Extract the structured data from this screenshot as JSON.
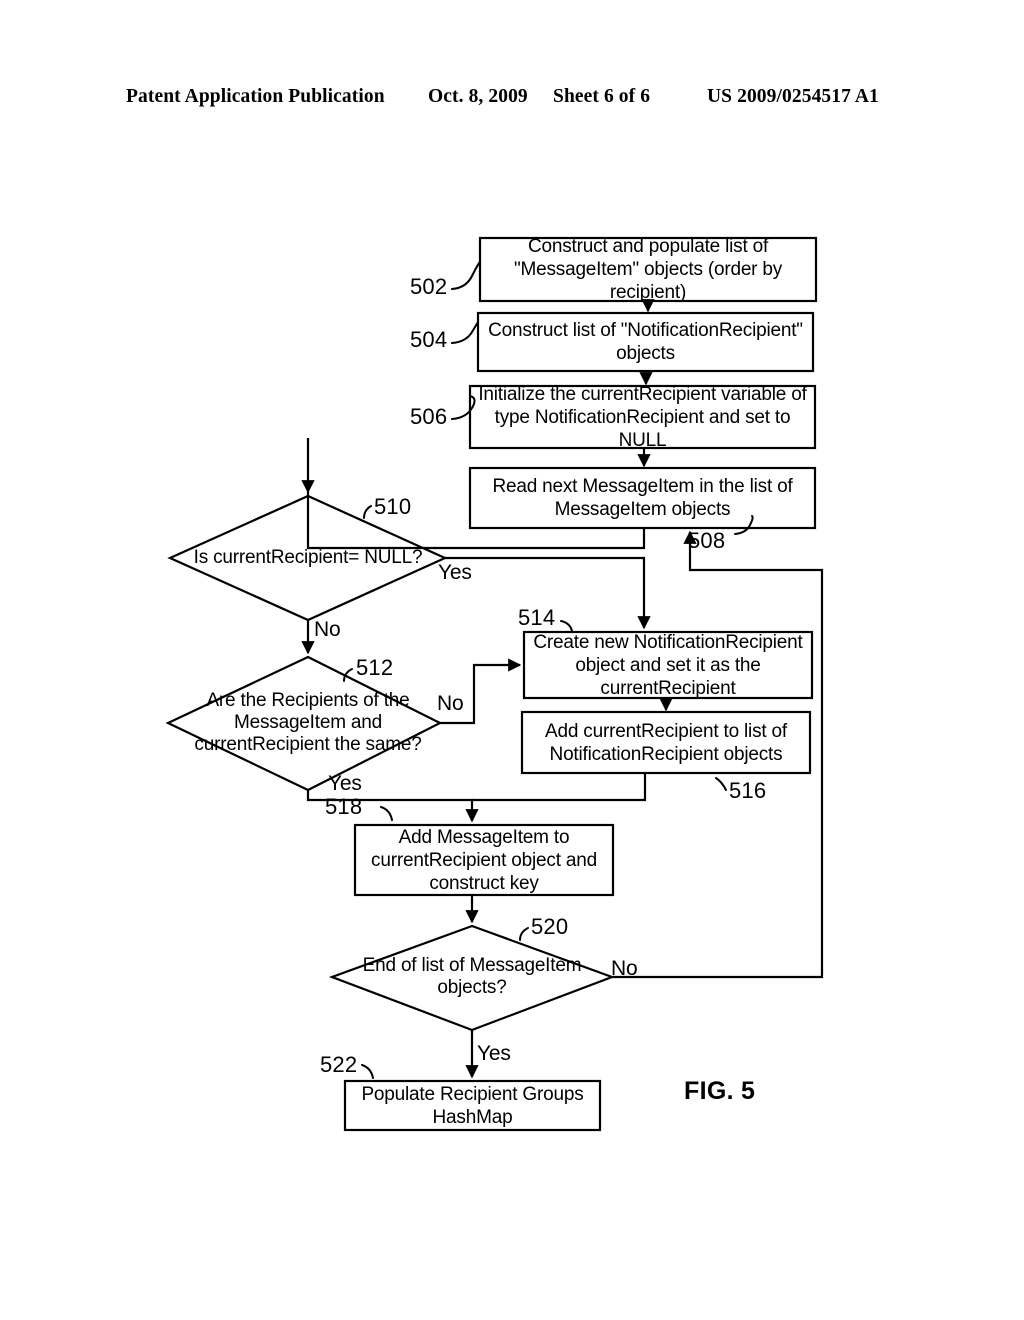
{
  "header": {
    "publication": "Patent Application Publication",
    "date": "Oct. 8, 2009",
    "sheet": "Sheet 6 of 6",
    "patent_number": "US 2009/0254517 A1"
  },
  "figure": {
    "label": "FIG. 5",
    "title": "FIG. 5"
  },
  "nodes": {
    "n502": {
      "ref": "502",
      "type": "process",
      "text": "Construct and populate list of\n\"MessageItem\" objects\n(order by recipient)"
    },
    "n504": {
      "ref": "504",
      "type": "process",
      "text": "Construct list of\n\"NotificationRecipient\" objects"
    },
    "n506": {
      "ref": "506",
      "type": "process",
      "text": "Initialize the currentRecipient variable\nof type NotificationRecipient and set to\nNULL"
    },
    "n508": {
      "ref": "508",
      "type": "process",
      "text": "Read next MessageItem in the list\nof MessageItem objects"
    },
    "n510": {
      "ref": "510",
      "type": "decision",
      "text": "Is currentRecipient=\nNULL?"
    },
    "n512": {
      "ref": "512",
      "type": "decision",
      "text": "Are the Recipients\nof the MessageItem and\ncurrentRecipient\nthe same?"
    },
    "n514": {
      "ref": "514",
      "type": "process",
      "text": "Create new\nNotificationRecipient object and\nset it as the currentRecipient"
    },
    "n516": {
      "ref": "516",
      "type": "process",
      "text": "Add currentRecipient to list of\nNotificationRecipient objects"
    },
    "n518": {
      "ref": "518",
      "type": "process",
      "text": "Add MessageItem to\ncurrentRecipient object and\nconstruct key"
    },
    "n520": {
      "ref": "520",
      "type": "decision",
      "text": "End of list of\nMessageItem objects?"
    },
    "n522": {
      "ref": "522",
      "type": "process",
      "text": "Populate Recipient Groups\nHashMap"
    }
  },
  "branch_labels": {
    "d510_yes": "Yes",
    "d510_no": "No",
    "d512_no": "No",
    "d512_yes": "Yes",
    "d520_no": "No",
    "d520_yes": "Yes"
  },
  "colors": {
    "ink": "#000000",
    "paper": "#ffffff"
  }
}
